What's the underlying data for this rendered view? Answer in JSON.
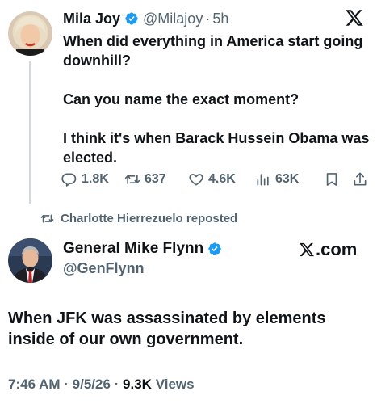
{
  "tweet1": {
    "author_name": "Mila Joy",
    "handle": "@Milajoy",
    "separator": "·",
    "time": "5h",
    "paragraphs": [
      "When did everything in America start going downhill?",
      "Can you name the exact moment?",
      "I think it's when Barack Hussein Obama was elected."
    ],
    "actions": {
      "replies": "1.8K",
      "reposts": "637",
      "likes": "4.6K",
      "views": "63K"
    }
  },
  "repost_banner": {
    "text": "Charlotte Hierrezuelo reposted"
  },
  "tweet2": {
    "author_name": "General Mike Flynn",
    "handle": "@GenFlynn",
    "source_brand": ".com",
    "body": "When JFK was assassinated by elements inside of our own government.",
    "meta_time_date": "7:46 AM · 9/5/26 · ",
    "meta_views_count": "9.3K",
    "meta_views_label": " Views"
  },
  "colors": {
    "verified": "#1d9bf0",
    "text_primary": "#0f1419",
    "text_secondary": "#536471"
  },
  "icons": [
    "verified-badge-icon",
    "x-logo-icon",
    "reply-icon",
    "repost-icon",
    "like-icon",
    "views-icon",
    "bookmark-icon",
    "share-icon"
  ]
}
